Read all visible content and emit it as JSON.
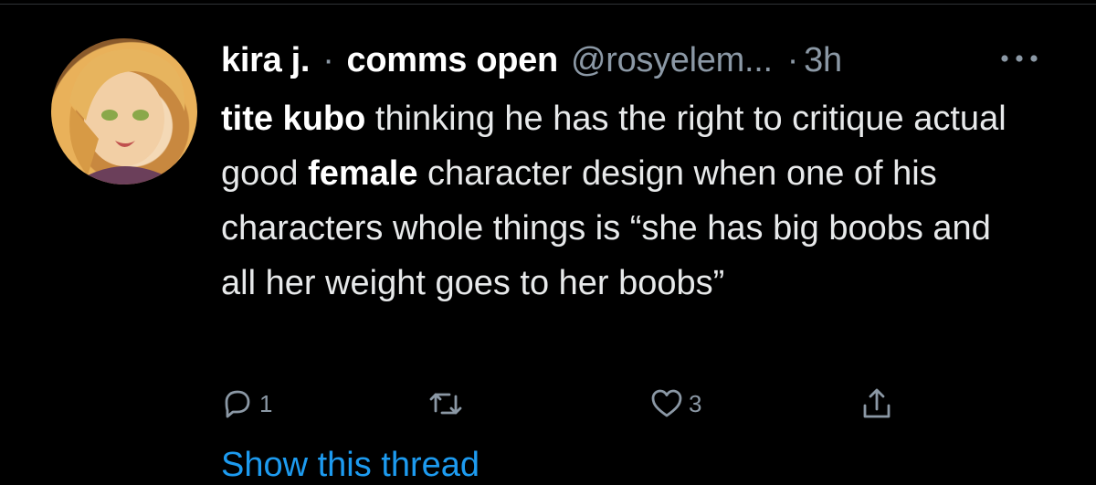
{
  "tweet": {
    "display_name": "kira j.",
    "separator": "·",
    "tagline": "comms open",
    "handle": "@rosyelem...",
    "time_separator": "·",
    "time": "3h",
    "text": {
      "part1_bold": "tite kubo",
      "part2": " thinking he has the right to critique actual good ",
      "part3_bold": "female",
      "part4": " character design when one of his characters whole things is “she has big boobs and all her weight goes to her boobs”"
    },
    "replies": "1",
    "retweets": "",
    "likes": "3",
    "show_thread_label": "Show this thread"
  },
  "icons": {
    "more": "more-horizontal-icon",
    "reply": "reply-icon",
    "retweet": "retweet-icon",
    "like": "heart-icon",
    "share": "share-icon"
  },
  "colors": {
    "background": "#000000",
    "text": "#e7e9ea",
    "secondary": "#8b98a5",
    "link": "#1d9bf0"
  }
}
